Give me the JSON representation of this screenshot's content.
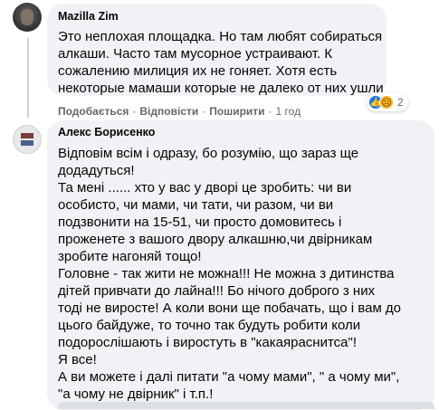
{
  "comments": [
    {
      "author": "Mazilla Zim",
      "text": "Это неплохая площадка. Но там любят собираться\nалкаши. Часто там мусорное устраивают. К\nсожалению милиция их не гоняет. Хотя есть\nнекоторые мамаши которые не далеко от них ушли",
      "actions": {
        "like": "Подобається",
        "reply": "Відповісти",
        "share": "Поширити",
        "time": "1 год"
      },
      "reactions": {
        "icons": [
          "like-icon",
          "sad-icon"
        ],
        "count": "2",
        "colors": {
          "like": "#1877f2",
          "sad": "#f7b125"
        }
      }
    },
    {
      "author": "Алекс Борисенко",
      "text": "Відповім всім і одразу, бо розумію, що зараз ще\nдодадуться!\nТа мені ...... хто у вас у дворі це зробить: чи ви\nособисто, чи мами, чи тати, чи разом, чи ви\nподзвонити на 15-51, чи просто домовитесь і\nпроженете з вашого двору алкашню,чи двірникам\nзробите нагоняй тощо!\nГоловне - так жити не можна!!! Не можна з дитинства\nдітей привчати до лайна!!! Бо нічого доброго з них\nтоді не виросте! А коли вони ще побачать, що і вам до\nцього байдуже, то точно так будуть робити коли\nподорослішають і виростуть в \"какаяраснитса\"!\nЯ все!\nА ви можете і далі питати \"а чому мами\", \" а чому ми\",\n\"а чому не двірник\" і т.п.!"
    }
  ],
  "colors": {
    "bubble": "#f0f2f5",
    "meta": "#65676b",
    "text": "#050505"
  }
}
